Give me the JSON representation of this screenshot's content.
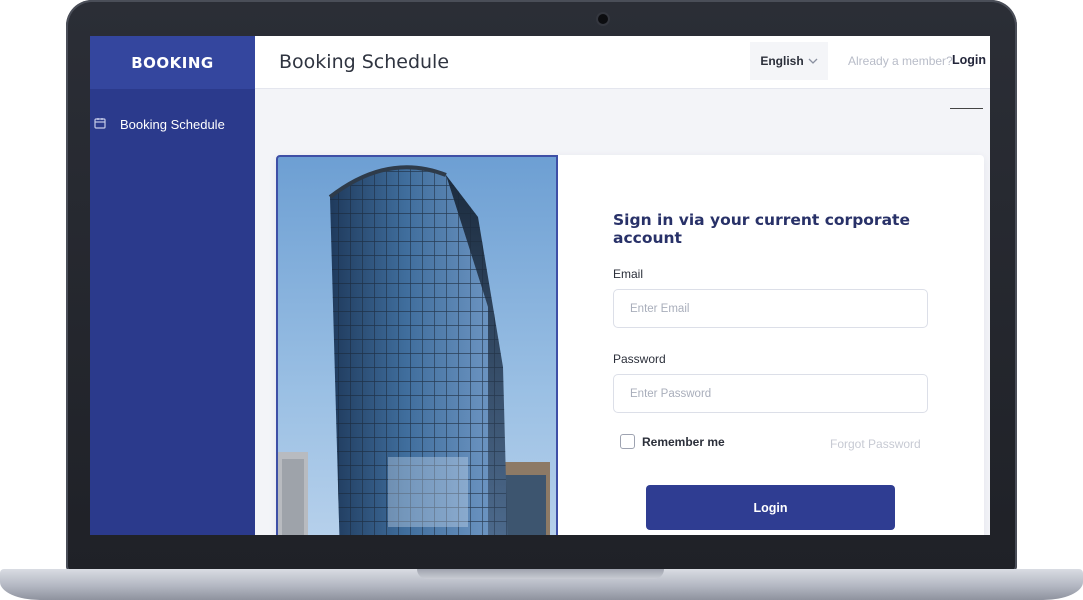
{
  "sidebar": {
    "brand": "BOOKING",
    "items": [
      {
        "label": "Booking Schedule",
        "icon": "calendar-icon"
      }
    ]
  },
  "header": {
    "title": "Booking Schedule",
    "language": "English",
    "member_prompt": "Already a member?",
    "login_link": "Login"
  },
  "login_form": {
    "title": "Sign in via your current corporate account",
    "email_label": "Email",
    "email_placeholder": "Enter Email",
    "password_label": "Password",
    "password_placeholder": "Enter Password",
    "remember_label": "Remember me",
    "forgot_label": "Forgot Password",
    "submit_label": "Login"
  },
  "colors": {
    "sidebar": "#2b3a8c",
    "brand_bar": "#34469e",
    "primary_button": "#2f3d92",
    "title_text": "#283168"
  }
}
